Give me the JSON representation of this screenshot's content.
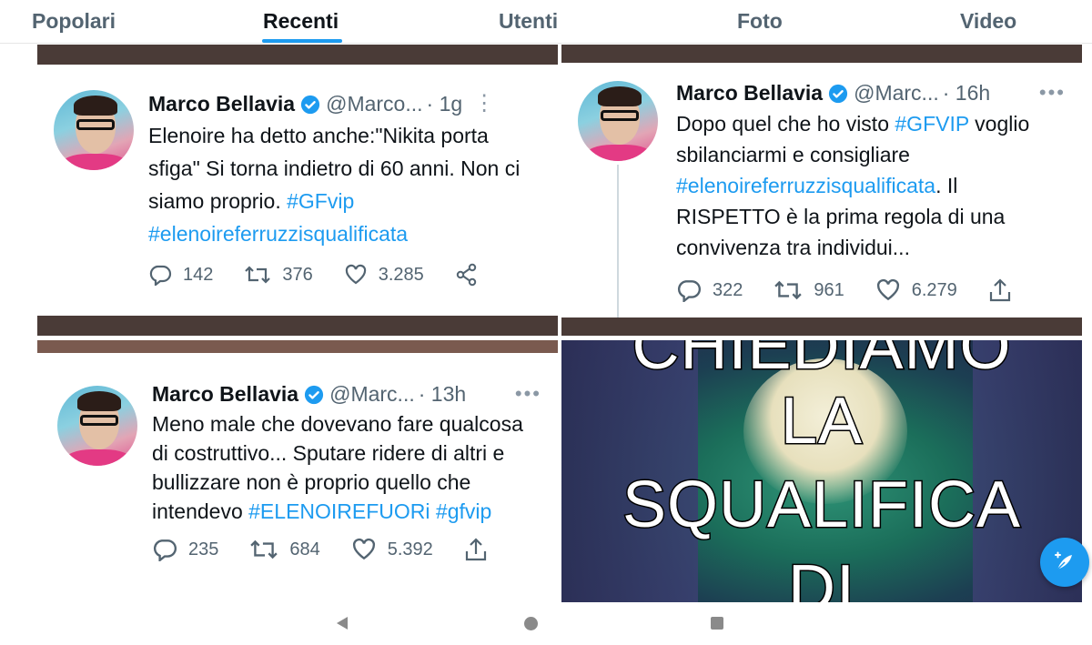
{
  "tabs": [
    {
      "label": "Popolari"
    },
    {
      "label": "Recenti"
    },
    {
      "label": "Utenti"
    },
    {
      "label": "Foto"
    },
    {
      "label": "Video"
    }
  ],
  "active_tab": "Recenti",
  "accent_color": "#1d9bf0",
  "tweets": [
    {
      "name": "Marco Bellavia",
      "handle": "@Marco...",
      "dot": "·",
      "time": "1g",
      "text_plain": "Elenoire ha detto anche:\"Nikita porta sfiga\"  Si torna indietro di 60 anni. Non ci siamo proprio. ",
      "hashtag1": "#GFvip",
      "hashtag2": "#elenoireferruzzisqualificata",
      "replies": "142",
      "retweets": "376",
      "likes": "3.285"
    },
    {
      "name": "Marco Bellavia",
      "handle": "@Marc...",
      "dot": "·",
      "time": "16h",
      "text_a": "Dopo quel che ho visto ",
      "hashtag1": "#GFVIP",
      "text_b": " voglio sbilanciarmi e consigliare ",
      "hashtag2": "#elenoireferruzzisqualificata",
      "text_c": ". Il RISPETTO è la prima regola di una convivenza tra individui...",
      "replies": "322",
      "retweets": "961",
      "likes": "6.279"
    },
    {
      "name": "Marco Bellavia",
      "handle": "@Marc...",
      "dot": "·",
      "time": "13h",
      "text_plain": "Meno male che dovevano fare qualcosa di costruttivo... Sputare ridere di altri e bullizzare non è proprio quello che intendevo ",
      "hashtag1": "#ELENOIREFUORi",
      "hashtag2": "#gfvip",
      "replies": "235",
      "retweets": "684",
      "likes": "5.392"
    }
  ],
  "meme": {
    "line1": "CHIEDIAMO",
    "line2": "LA",
    "line3": "SQUALIFICA",
    "line4": "DI"
  }
}
